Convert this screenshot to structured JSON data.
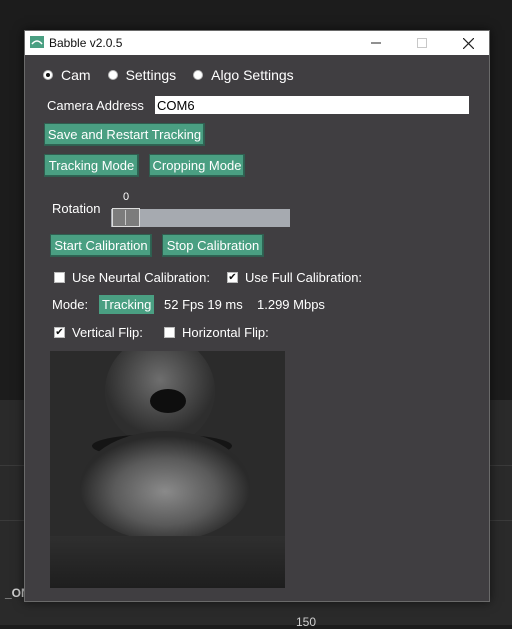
{
  "window": {
    "title": "Babble v2.0.5"
  },
  "tabs": [
    {
      "label": "Cam",
      "selected": true
    },
    {
      "label": "Settings",
      "selected": false
    },
    {
      "label": "Algo Settings",
      "selected": false
    }
  ],
  "camera_address": {
    "label": "Camera Address",
    "value": "COM6"
  },
  "buttons": {
    "save_restart": "Save and Restart Tracking",
    "tracking_mode": "Tracking Mode",
    "cropping_mode": "Cropping Mode",
    "start_calibration": "Start Calibration",
    "stop_calibration": "Stop Calibration"
  },
  "rotation": {
    "label": "Rotation",
    "value": "0"
  },
  "calibration": {
    "neutral": {
      "label": "Use Neurtal Calibration:",
      "checked": false
    },
    "full": {
      "label": "Use Full Calibration:",
      "checked": true
    }
  },
  "status": {
    "mode_label": "Mode:",
    "mode_value": "Tracking",
    "fps": "52 Fps 19 ms",
    "bandwidth": "1.299 Mbps"
  },
  "flip": {
    "vertical": {
      "label": "Vertical Flip:",
      "checked": true
    },
    "horizontal": {
      "label": "Horizontal Flip:",
      "checked": false
    }
  },
  "background": {
    "text_left": "_ON",
    "text_bottom": "150"
  },
  "colors": {
    "accent": "#4a9f82",
    "window_bg": "#403e41",
    "titlebar": "#ffffff"
  },
  "icons": {
    "app": "babble-app-icon",
    "minimize": "minimize-icon",
    "maximize": "maximize-icon",
    "close": "close-icon"
  }
}
